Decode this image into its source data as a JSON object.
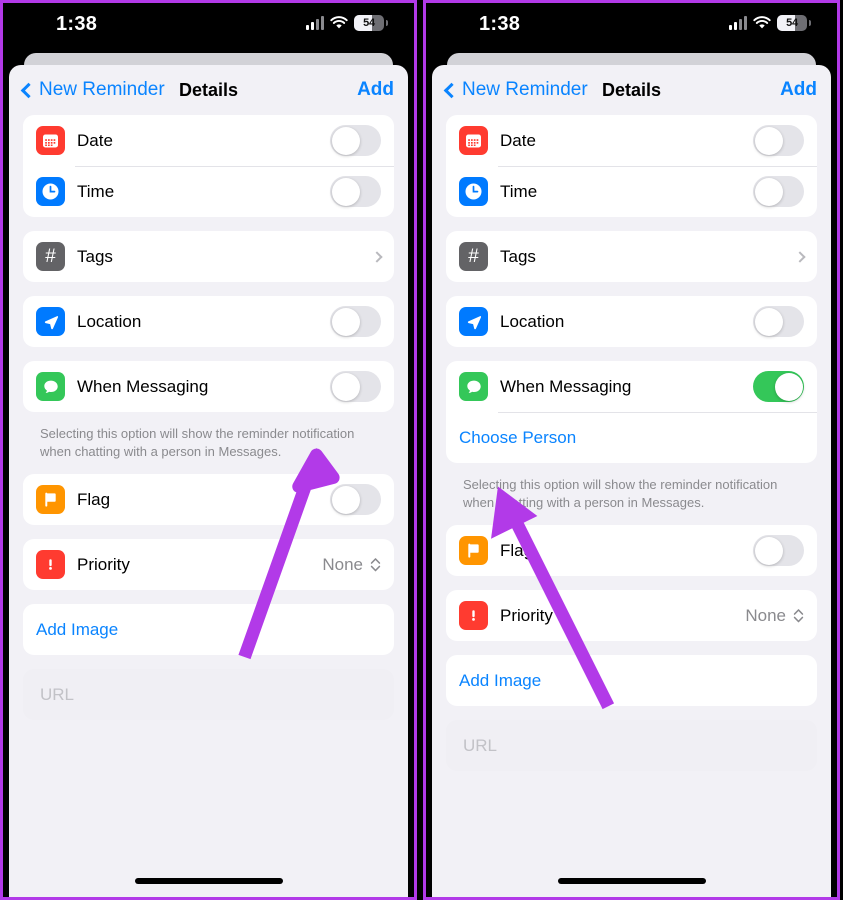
{
  "accent_colors": {
    "annotation_arrow": "#b23ae8",
    "ios_blue": "#0a84ff",
    "toggle_on_green": "#34c759",
    "date_icon": "#ff3b30",
    "time_icon": "#007aff",
    "tags_icon": "#636366",
    "location_icon": "#007aff",
    "messaging_icon": "#34c759",
    "flag_icon": "#ff9500",
    "priority_icon": "#ff3b30"
  },
  "status_bar": {
    "time": "1:38",
    "battery_percent": "54",
    "cellular_icon": "cellular-signal-icon",
    "wifi_icon": "wifi-icon",
    "battery_icon": "battery-icon"
  },
  "nav": {
    "back_label": "New Reminder",
    "back_icon": "chevron-left-icon",
    "title": "Details",
    "add_label": "Add"
  },
  "rows": {
    "date": {
      "label": "Date",
      "icon": "calendar-icon",
      "glyph": "▦"
    },
    "time": {
      "label": "Time",
      "icon": "clock-icon",
      "glyph": "◷"
    },
    "tags": {
      "label": "Tags",
      "icon": "hashtag-icon",
      "glyph": "#",
      "disclosure": "chevron-right-icon"
    },
    "location": {
      "label": "Location",
      "icon": "location-arrow-icon",
      "glyph": "➤"
    },
    "when_messaging": {
      "label": "When Messaging",
      "icon": "message-bubble-icon",
      "glyph": "▬"
    },
    "flag": {
      "label": "Flag",
      "icon": "flag-icon",
      "glyph": "⚑"
    },
    "priority": {
      "label": "Priority",
      "icon": "exclamation-icon",
      "glyph": "!",
      "value": "None",
      "stepper_icon": "up-down-chevron-icon"
    },
    "add_image": {
      "label": "Add Image"
    },
    "url": {
      "placeholder": "URL"
    }
  },
  "footnote": "Selecting this option will show the reminder notification when chatting with a person in Messages.",
  "choose_person": {
    "label": "Choose Person"
  },
  "panels": {
    "left": {
      "when_messaging_on": false,
      "shows_choose_person": false
    },
    "right": {
      "when_messaging_on": true,
      "shows_choose_person": true
    }
  }
}
